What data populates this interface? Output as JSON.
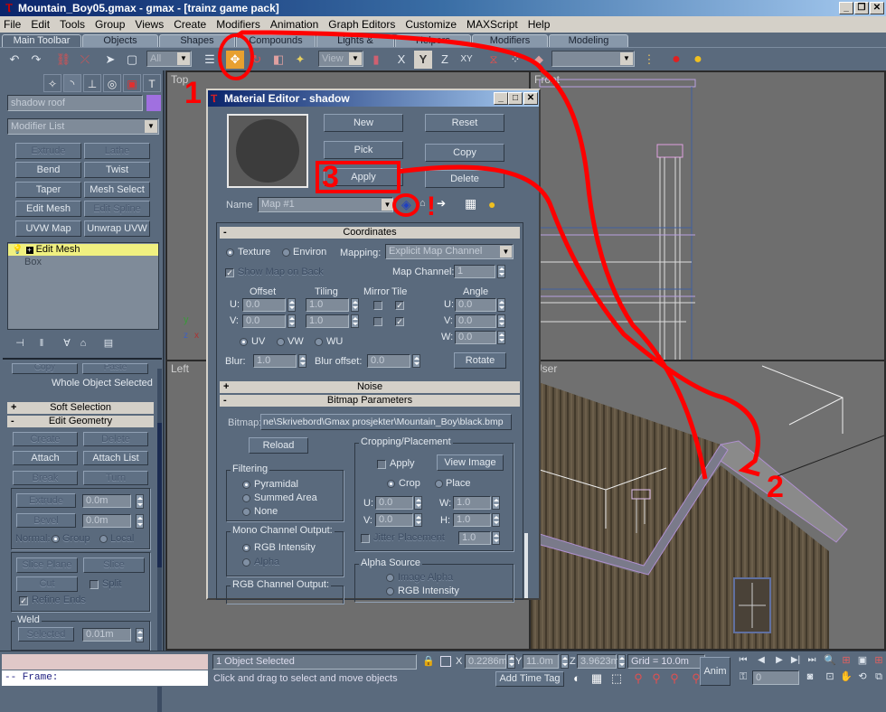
{
  "window": {
    "title": "Mountain_Boy05.gmax - gmax - [trainz game pack]",
    "controls": {
      "minimize": "_",
      "restore": "❐",
      "close": "✕"
    }
  },
  "menu": [
    "File",
    "Edit",
    "Tools",
    "Group",
    "Views",
    "Create",
    "Modifiers",
    "Animation",
    "Graph Editors",
    "Customize",
    "MAXScript",
    "Help"
  ],
  "tabs": [
    "Main Toolbar",
    "Objects",
    "Shapes",
    "Compounds",
    "Lights & Cameras",
    "Helpers",
    "Modifiers",
    "Modeling"
  ],
  "toolbar": {
    "selection_filter": "All",
    "reference_coord": "View",
    "named_selection": "",
    "axis_x": "X",
    "axis_y": "Y",
    "axis_z": "Z",
    "axis_xy": "XY",
    "icons": [
      "undo-icon",
      "redo-icon",
      "link-icon",
      "unlink-icon",
      "select-icon",
      "region-select-icon",
      "select-by-name-icon",
      "move-icon",
      "rotate-icon",
      "scale-icon",
      "pivot-icon",
      "mirror-icon",
      "array-icon",
      "align-icon",
      "named-selection-icon",
      "material-editor-icon",
      "render-icon"
    ]
  },
  "command_panel": {
    "object_name": "shadow roof",
    "object_color": "#a070e0",
    "modifier_list": "Modifier List",
    "modifier_buttons": [
      {
        "label": "Extrude",
        "enabled": false
      },
      {
        "label": "Lathe",
        "enabled": false
      },
      {
        "label": "Bend",
        "enabled": true
      },
      {
        "label": "Twist",
        "enabled": true
      },
      {
        "label": "Taper",
        "enabled": true
      },
      {
        "label": "Mesh Select",
        "enabled": true
      },
      {
        "label": "Edit Mesh",
        "enabled": true
      },
      {
        "label": "Edit Spline",
        "enabled": false
      },
      {
        "label": "UVW Map",
        "enabled": true
      },
      {
        "label": "Unwrap UVW",
        "enabled": true
      }
    ],
    "stack": [
      {
        "label": "Edit Mesh",
        "selected": true
      },
      {
        "label": "Box",
        "selected": false
      }
    ],
    "selection_status": "Whole Object Selected",
    "copy_label": "Copy",
    "paste_label": "Paste",
    "soft_selection": "Soft Selection",
    "edit_geometry": "Edit Geometry",
    "geometry_buttons": {
      "create": "Create",
      "delete": "Delete",
      "attach": "Attach",
      "attach_list": "Attach List",
      "break": "Break",
      "turn": "Turn",
      "extrude": "Extrude",
      "extrude_value": "0.0m",
      "bevel": "Bevel",
      "bevel_value": "0.0m",
      "normal_label": "Normal:",
      "group": "Group",
      "local": "Local",
      "slice_plane": "Slice Plane",
      "slice": "Slice",
      "cut": "Cut",
      "split": "Split",
      "refine_ends": "Refine Ends",
      "weld_label": "Weld",
      "weld_selected": "Selected",
      "weld_value": "0.01m"
    }
  },
  "viewports": {
    "top": "Top",
    "front": "Front",
    "left": "Left",
    "user": "User"
  },
  "material_editor": {
    "title": "Material Editor - shadow",
    "buttons": {
      "new": "New",
      "reset": "Reset",
      "pick": "Pick",
      "copy": "Copy",
      "apply": "Apply",
      "delete": "Delete"
    },
    "name_label": "Name",
    "name_value": "Map #1",
    "coordinates": {
      "header": "Coordinates",
      "texture": "Texture",
      "environ": "Environ",
      "mapping_label": "Mapping:",
      "mapping_value": "Explicit Map Channel",
      "show_map_on_back": "Show Map on Back",
      "map_channel_label": "Map Channel:",
      "map_channel_value": "1",
      "offset": "Offset",
      "tiling": "Tiling",
      "mirror": "Mirror",
      "tile": "Tile",
      "angle": "Angle",
      "u": "U:",
      "v": "V:",
      "w": "W:",
      "offset_u": "0.0",
      "offset_v": "0.0",
      "tiling_u": "1.0",
      "tiling_v": "1.0",
      "angle_u": "0.0",
      "angle_v": "0.0",
      "angle_w": "0.0",
      "uv": "UV",
      "vw": "VW",
      "wu": "WU",
      "blur_label": "Blur:",
      "blur_value": "1.0",
      "blur_offset_label": "Blur offset:",
      "blur_offset_value": "0.0",
      "rotate": "Rotate"
    },
    "noise_header": "Noise",
    "bitmap": {
      "header": "Bitmap Parameters",
      "bitmap_label": "Bitmap:",
      "bitmap_path": "ne\\Skrivebord\\Gmax prosjekter\\Mountain_Boy\\black.bmp",
      "reload": "Reload",
      "filtering": "Filtering",
      "pyramidal": "Pyramidal",
      "summed_area": "Summed Area",
      "none": "None",
      "mono_output": "Mono Channel Output:",
      "rgb_intensity": "RGB Intensity",
      "alpha": "Alpha",
      "rgb_output": "RGB Channel Output:",
      "cropping": "Cropping/Placement",
      "apply": "Apply",
      "view_image": "View Image",
      "crop": "Crop",
      "place": "Place",
      "u_value": "0.0",
      "v_value": "0.0",
      "w_value": "1.0",
      "h_value": "1.0",
      "w_label": "W:",
      "h_label": "H:",
      "jitter": "Jitter Placement",
      "jitter_value": "1.0",
      "alpha_source": "Alpha Source",
      "image_alpha": "Image Alpha",
      "alpha_rgb_intensity": "RGB Intensity"
    }
  },
  "annotations": {
    "one": "1",
    "two": "2",
    "three": "3",
    "exclamation": "!"
  },
  "status": {
    "maxscript_line": "-- Frame:",
    "selected": "1 Object Selected",
    "prompt": "Click and drag to select and move objects",
    "x": "0.2286m",
    "y": "11.0m",
    "z": "3.9623m",
    "x_label": "X",
    "y_label": "Y",
    "z_label": "Z",
    "grid": "Grid = 10.0m",
    "add_time_tag": "Add Time Tag",
    "anim": "Anim",
    "frame": "0"
  }
}
